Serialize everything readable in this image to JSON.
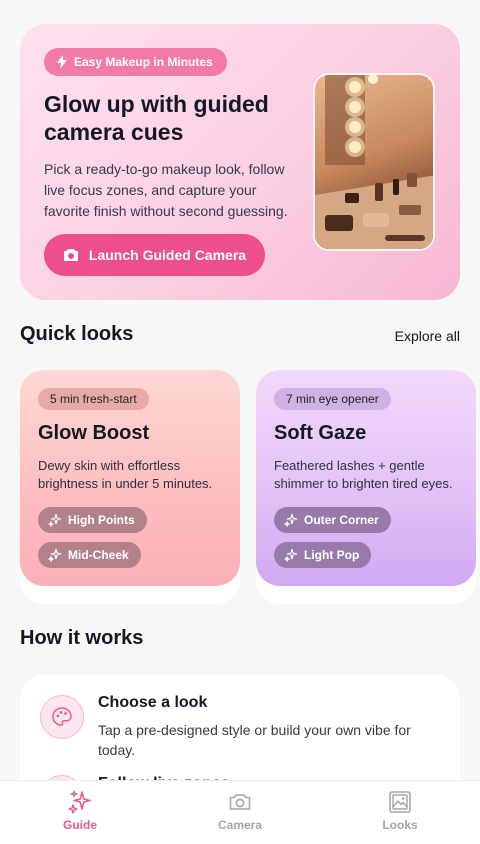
{
  "hero": {
    "badge": "Easy Makeup in Minutes",
    "title": "Glow up with guided camera cues",
    "description": "Pick a ready-to-go makeup look, follow live focus zones, and capture your favorite finish without second guessing.",
    "button_label": "Launch Guided Camera"
  },
  "quick_looks": {
    "title": "Quick looks",
    "explore_label": "Explore all",
    "cards": [
      {
        "badge": "5 min fresh-start",
        "title": "Glow Boost",
        "description": "Dewy skin with effortless brightness in under 5 minutes.",
        "chips": [
          "High Points",
          "Mid-Cheek"
        ]
      },
      {
        "badge": "7 min eye opener",
        "title": "Soft Gaze",
        "description": "Feathered lashes + gentle shimmer to brighten tired eyes.",
        "chips": [
          "Outer Corner",
          "Light Pop"
        ]
      }
    ]
  },
  "how_it_works": {
    "title": "How it works",
    "steps": [
      {
        "title": "Choose a look",
        "description": "Tap a pre-designed style or build your own vibe for today."
      },
      {
        "title": "Follow live zones"
      }
    ]
  },
  "nav": {
    "items": [
      {
        "label": "Guide",
        "icon": "sparkles-icon"
      },
      {
        "label": "Camera",
        "icon": "camera-icon"
      },
      {
        "label": "Looks",
        "icon": "gallery-icon"
      }
    ]
  },
  "colors": {
    "accent": "#ec4f8c",
    "nav_active": "#e85a92",
    "nav_inactive": "#a3a6ae"
  }
}
